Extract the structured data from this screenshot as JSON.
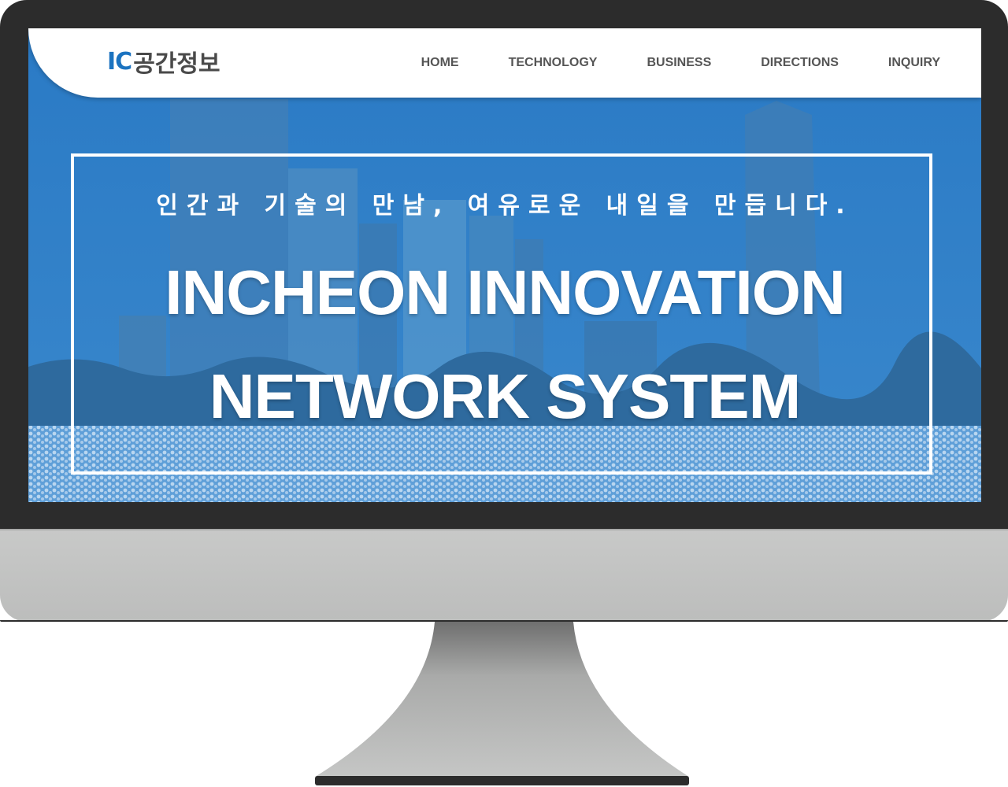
{
  "header": {
    "logo_mark": "IC",
    "logo_text": "공간정보"
  },
  "nav": {
    "items": [
      "HOME",
      "TECHNOLOGY",
      "BUSINESS",
      "DIRECTIONS",
      "INQUIRY"
    ]
  },
  "hero": {
    "slogan": "인간과 기술의 만남, 여유로운 내일을 만듭니다.",
    "title_line1": "INCHEON INNOVATION",
    "title_line2": "NETWORK SYSTEM"
  },
  "colors": {
    "accent": "#1c73c0",
    "hero_overlay": "#2f7fc4",
    "bezel": "#2c2c2c",
    "chin": "#c3c4c3"
  }
}
